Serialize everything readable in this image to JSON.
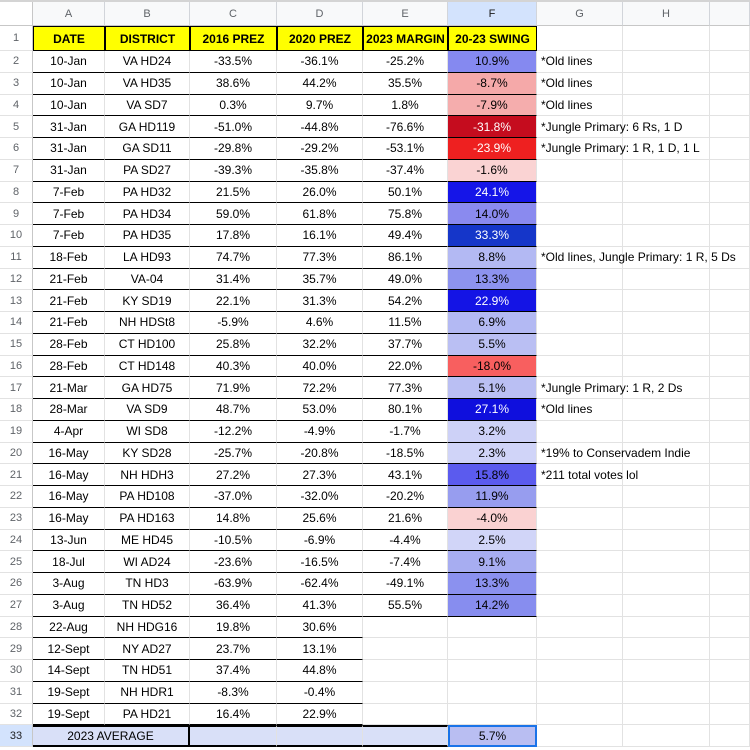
{
  "sheet": {
    "column_letters": [
      "A",
      "B",
      "C",
      "D",
      "E",
      "F",
      "G",
      "H"
    ],
    "selected_column": "F",
    "header": {
      "row_num": "1",
      "cells": [
        "DATE",
        "DISTRICT",
        "2016 PREZ",
        "2020 PREZ",
        "2023 MARGIN",
        "20-23 SWING"
      ]
    },
    "rows": [
      {
        "n": "2",
        "date": "10-Jan",
        "district": "VA HD24",
        "prez2016": "-33.5%",
        "prez2020": "-36.1%",
        "margin2023": "-25.2%",
        "swing": "10.9%",
        "swing_bg": "#8589f0",
        "swing_fg": "#000000",
        "note": "*Old lines"
      },
      {
        "n": "3",
        "date": "10-Jan",
        "district": "VA HD35",
        "prez2016": "38.6%",
        "prez2020": "44.2%",
        "margin2023": "35.5%",
        "swing": "-8.7%",
        "swing_bg": "#f5a9a9",
        "swing_fg": "#000000",
        "note": "*Old lines"
      },
      {
        "n": "4",
        "date": "10-Jan",
        "district": "VA SD7",
        "prez2016": "0.3%",
        "prez2020": "9.7%",
        "margin2023": "1.8%",
        "swing": "-7.9%",
        "swing_bg": "#f5adad",
        "swing_fg": "#000000",
        "note": "*Old lines"
      },
      {
        "n": "5",
        "date": "31-Jan",
        "district": "GA HD119",
        "prez2016": "-51.0%",
        "prez2020": "-44.8%",
        "margin2023": "-76.6%",
        "swing": "-31.8%",
        "swing_bg": "#c50c1e",
        "swing_fg": "#ffffff",
        "note": "*Jungle Primary: 6 Rs, 1 D"
      },
      {
        "n": "6",
        "date": "31-Jan",
        "district": "GA SD11",
        "prez2016": "-29.8%",
        "prez2020": "-29.2%",
        "margin2023": "-53.1%",
        "swing": "-23.9%",
        "swing_bg": "#ee2020",
        "swing_fg": "#ffffff",
        "note": "*Jungle Primary: 1 R, 1 D, 1 L"
      },
      {
        "n": "7",
        "date": "31-Jan",
        "district": "PA SD27",
        "prez2016": "-39.3%",
        "prez2020": "-35.8%",
        "margin2023": "-37.4%",
        "swing": "-1.6%",
        "swing_bg": "#fad3d3",
        "swing_fg": "#000000",
        "note": ""
      },
      {
        "n": "8",
        "date": "7-Feb",
        "district": "PA HD32",
        "prez2016": "21.5%",
        "prez2020": "26.0%",
        "margin2023": "50.1%",
        "swing": "24.1%",
        "swing_bg": "#1515e8",
        "swing_fg": "#ffffff",
        "note": ""
      },
      {
        "n": "9",
        "date": "7-Feb",
        "district": "PA HD34",
        "prez2016": "59.0%",
        "prez2020": "61.8%",
        "margin2023": "75.8%",
        "swing": "14.0%",
        "swing_bg": "#8a8aef",
        "swing_fg": "#000000",
        "note": ""
      },
      {
        "n": "10",
        "date": "7-Feb",
        "district": "PA HD35",
        "prez2016": "17.8%",
        "prez2020": "16.1%",
        "margin2023": "49.4%",
        "swing": "33.3%",
        "swing_bg": "#1536c9",
        "swing_fg": "#ffffff",
        "note": ""
      },
      {
        "n": "11",
        "date": "18-Feb",
        "district": "LA HD93",
        "prez2016": "74.7%",
        "prez2020": "77.3%",
        "margin2023": "86.1%",
        "swing": "8.8%",
        "swing_bg": "#b3b9f3",
        "swing_fg": "#000000",
        "note": "*Old lines, Jungle Primary: 1 R, 5 Ds"
      },
      {
        "n": "12",
        "date": "21-Feb",
        "district": "VA-04",
        "prez2016": "31.4%",
        "prez2020": "35.7%",
        "margin2023": "49.0%",
        "swing": "13.3%",
        "swing_bg": "#8d93ef",
        "swing_fg": "#000000",
        "note": ""
      },
      {
        "n": "13",
        "date": "21-Feb",
        "district": "KY SD19",
        "prez2016": "22.1%",
        "prez2020": "31.3%",
        "margin2023": "54.2%",
        "swing": "22.9%",
        "swing_bg": "#1414e5",
        "swing_fg": "#ffffff",
        "note": ""
      },
      {
        "n": "14",
        "date": "21-Feb",
        "district": "NH HDSt8",
        "prez2016": "-5.9%",
        "prez2020": "4.6%",
        "margin2023": "11.5%",
        "swing": "6.9%",
        "swing_bg": "#b3b9f3",
        "swing_fg": "#000000",
        "note": ""
      },
      {
        "n": "15",
        "date": "28-Feb",
        "district": "CT HD100",
        "prez2016": "25.8%",
        "prez2020": "32.2%",
        "margin2023": "37.7%",
        "swing": "5.5%",
        "swing_bg": "#babff3",
        "swing_fg": "#000000",
        "note": ""
      },
      {
        "n": "16",
        "date": "28-Feb",
        "district": "CT HD148",
        "prez2016": "40.3%",
        "prez2020": "40.0%",
        "margin2023": "22.0%",
        "swing": "-18.0%",
        "swing_bg": "#f85f5f",
        "swing_fg": "#000000",
        "note": ""
      },
      {
        "n": "17",
        "date": "21-Mar",
        "district": "GA HD75",
        "prez2016": "71.9%",
        "prez2020": "72.2%",
        "margin2023": "77.3%",
        "swing": "5.1%",
        "swing_bg": "#babff3",
        "swing_fg": "#000000",
        "note": "*Jungle Primary: 1 R, 2 Ds"
      },
      {
        "n": "18",
        "date": "28-Mar",
        "district": "VA SD9",
        "prez2016": "48.7%",
        "prez2020": "53.0%",
        "margin2023": "80.1%",
        "swing": "27.1%",
        "swing_bg": "#0f0fdd",
        "swing_fg": "#ffffff",
        "note": "*Old lines"
      },
      {
        "n": "19",
        "date": "4-Apr",
        "district": "WI SD8",
        "prez2016": "-12.2%",
        "prez2020": "-4.9%",
        "margin2023": "-1.7%",
        "swing": "3.2%",
        "swing_bg": "#cdd1f7",
        "swing_fg": "#000000",
        "note": ""
      },
      {
        "n": "20",
        "date": "16-May",
        "district": "KY SD28",
        "prez2016": "-25.7%",
        "prez2020": "-20.8%",
        "margin2023": "-18.5%",
        "swing": "2.3%",
        "swing_bg": "#d0d4f8",
        "swing_fg": "#000000",
        "note": "*19% to Conservadem Indie"
      },
      {
        "n": "21",
        "date": "16-May",
        "district": "NH HDH3",
        "prez2016": "27.2%",
        "prez2020": "27.3%",
        "margin2023": "43.1%",
        "swing": "15.8%",
        "swing_bg": "#5b5bee",
        "swing_fg": "#000000",
        "note": "*211 total votes lol"
      },
      {
        "n": "22",
        "date": "16-May",
        "district": "PA HD108",
        "prez2016": "-37.0%",
        "prez2020": "-32.0%",
        "margin2023": "-20.2%",
        "swing": "11.9%",
        "swing_bg": "#979def",
        "swing_fg": "#000000",
        "note": ""
      },
      {
        "n": "23",
        "date": "16-May",
        "district": "PA HD163",
        "prez2016": "14.8%",
        "prez2020": "25.6%",
        "margin2023": "21.6%",
        "swing": "-4.0%",
        "swing_bg": "#fad2d2",
        "swing_fg": "#000000",
        "note": ""
      },
      {
        "n": "24",
        "date": "13-Jun",
        "district": "ME HD45",
        "prez2016": "-10.5%",
        "prez2020": "-6.9%",
        "margin2023": "-4.4%",
        "swing": "2.5%",
        "swing_bg": "#d1d5f8",
        "swing_fg": "#000000",
        "note": ""
      },
      {
        "n": "25",
        "date": "18-Jul",
        "district": "WI AD24",
        "prez2016": "-23.6%",
        "prez2020": "-16.5%",
        "margin2023": "-7.4%",
        "swing": "9.1%",
        "swing_bg": "#a7adf1",
        "swing_fg": "#000000",
        "note": ""
      },
      {
        "n": "26",
        "date": "3-Aug",
        "district": "TN HD3",
        "prez2016": "-63.9%",
        "prez2020": "-62.4%",
        "margin2023": "-49.1%",
        "swing": "13.3%",
        "swing_bg": "#8b91ef",
        "swing_fg": "#000000",
        "note": ""
      },
      {
        "n": "27",
        "date": "3-Aug",
        "district": "TN HD52",
        "prez2016": "36.4%",
        "prez2020": "41.3%",
        "margin2023": "55.5%",
        "swing": "14.2%",
        "swing_bg": "#878def",
        "swing_fg": "#000000",
        "note": ""
      },
      {
        "n": "28",
        "date": "22-Aug",
        "district": "NH HDG16",
        "prez2016": "19.8%",
        "prez2020": "30.6%",
        "margin2023": "",
        "swing": "",
        "swing_bg": "",
        "swing_fg": "",
        "note": ""
      },
      {
        "n": "29",
        "date": "12-Sept",
        "district": "NY AD27",
        "prez2016": "23.7%",
        "prez2020": "13.1%",
        "margin2023": "",
        "swing": "",
        "swing_bg": "",
        "swing_fg": "",
        "note": ""
      },
      {
        "n": "30",
        "date": "14-Sept",
        "district": "TN HD51",
        "prez2016": "37.4%",
        "prez2020": "44.8%",
        "margin2023": "",
        "swing": "",
        "swing_bg": "",
        "swing_fg": "",
        "note": ""
      },
      {
        "n": "31",
        "date": "19-Sept",
        "district": "NH HDR1",
        "prez2016": "-8.3%",
        "prez2020": "-0.4%",
        "margin2023": "",
        "swing": "",
        "swing_bg": "",
        "swing_fg": "",
        "note": ""
      },
      {
        "n": "32",
        "date": "19-Sept",
        "district": "PA HD21",
        "prez2016": "16.4%",
        "prez2020": "22.9%",
        "margin2023": "",
        "swing": "",
        "swing_bg": "",
        "swing_fg": "",
        "note": ""
      }
    ],
    "average_row": {
      "n": "33",
      "label": "2023 AVERAGE",
      "swing": "5.7%",
      "swing_bg": "#b9bef2",
      "row_bg": "#d9e0f8"
    },
    "colors": {
      "header_bg": "#ffff00",
      "selection_border": "#1a73e8",
      "selected_header_bg": "#d3e3fd",
      "gridline": "#e2e2e2",
      "swing_positive_strong": "#1515e8",
      "swing_negative_strong": "#c50c1e"
    }
  }
}
